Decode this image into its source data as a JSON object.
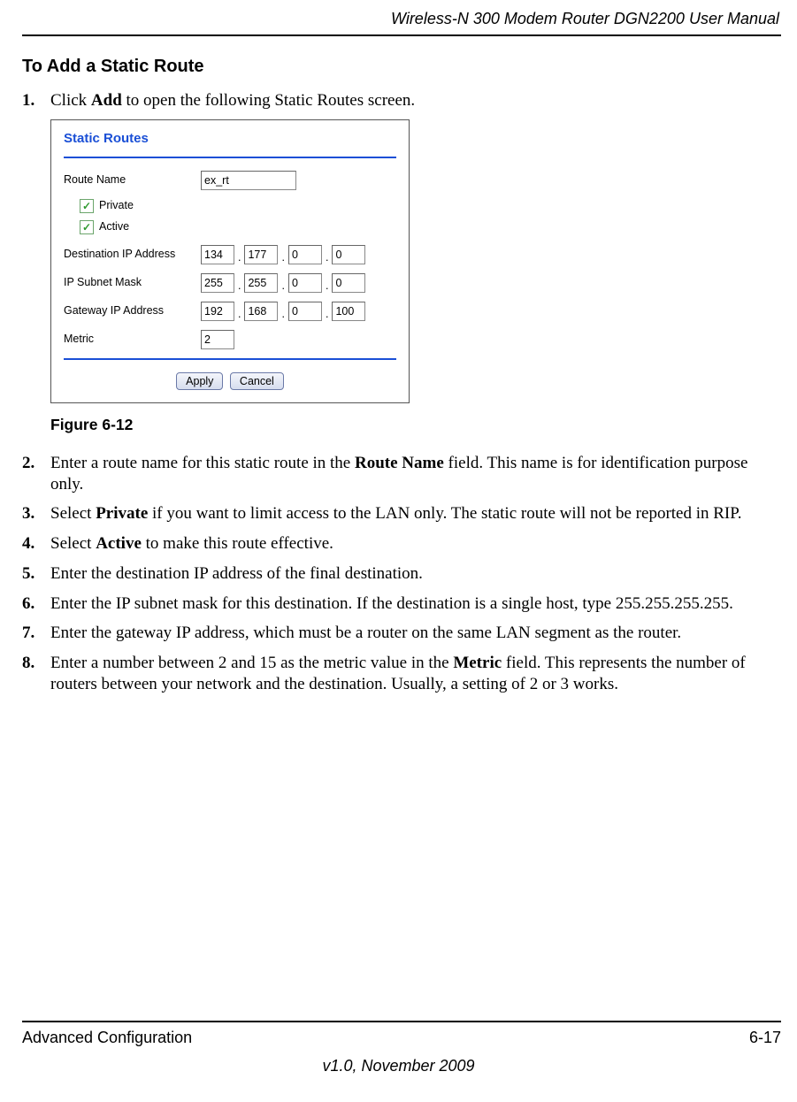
{
  "header": {
    "running_title": "Wireless-N 300 Modem Router DGN2200 User Manual"
  },
  "section": {
    "heading": "To Add a Static Route",
    "figure_label": "Figure 6-12",
    "steps": [
      {
        "num": "1.",
        "segments": [
          {
            "t": "Click "
          },
          {
            "t": "Add",
            "b": true
          },
          {
            "t": " to open the following Static Routes screen."
          }
        ]
      },
      {
        "num": "2.",
        "segments": [
          {
            "t": "Enter a route name for this static route in the "
          },
          {
            "t": "Route Name",
            "b": true
          },
          {
            "t": " field. This name is for identification purpose only."
          }
        ]
      },
      {
        "num": "3.",
        "segments": [
          {
            "t": "Select "
          },
          {
            "t": "Private",
            "b": true
          },
          {
            "t": " if you want to limit access to the LAN only. The static route will not be reported in RIP."
          }
        ]
      },
      {
        "num": "4.",
        "segments": [
          {
            "t": "Select "
          },
          {
            "t": "Active",
            "b": true
          },
          {
            "t": " to make this route effective."
          }
        ]
      },
      {
        "num": "5.",
        "segments": [
          {
            "t": "Enter the destination IP address of the final destination."
          }
        ]
      },
      {
        "num": "6.",
        "segments": [
          {
            "t": "Enter the IP subnet mask for this destination. If the destination is a single host, type 255.255.255.255."
          }
        ]
      },
      {
        "num": "7.",
        "segments": [
          {
            "t": "Enter the gateway IP address, which must be a router on the same LAN segment as the router."
          }
        ]
      },
      {
        "num": "8.",
        "segments": [
          {
            "t": "Enter a number between 2 and 15 as the metric value in the "
          },
          {
            "t": "Metric",
            "b": true
          },
          {
            "t": " field. This represents the number of routers between your network and the destination. Usually, a setting of 2 or 3 works."
          }
        ]
      }
    ]
  },
  "panel": {
    "title": "Static Routes",
    "labels": {
      "route_name": "Route Name",
      "private": "Private",
      "active": "Active",
      "dest_ip": "Destination IP Address",
      "subnet": "IP Subnet Mask",
      "gateway": "Gateway IP Address",
      "metric": "Metric"
    },
    "values": {
      "route_name": "ex_rt",
      "private_checked": true,
      "active_checked": true,
      "dest_ip": [
        "134",
        "177",
        "0",
        "0"
      ],
      "subnet": [
        "255",
        "255",
        "0",
        "0"
      ],
      "gateway": [
        "192",
        "168",
        "0",
        "100"
      ],
      "metric": "2"
    },
    "buttons": {
      "apply": "Apply",
      "cancel": "Cancel"
    }
  },
  "footer": {
    "section": "Advanced Configuration",
    "page": "6-17",
    "version": "v1.0, November 2009"
  }
}
